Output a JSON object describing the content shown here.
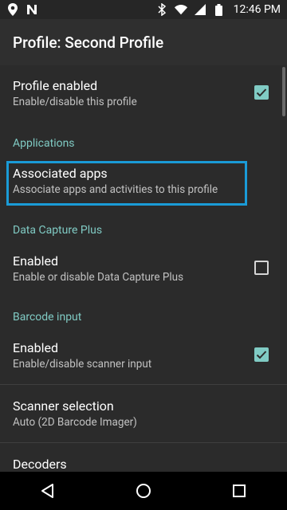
{
  "status": {
    "time": "12:46 PM"
  },
  "appbar": {
    "title": "Profile: Second Profile"
  },
  "items": {
    "profile_enabled": {
      "title": "Profile enabled",
      "summary": "Enable/disable this profile",
      "checked": true
    },
    "cat_applications": "Applications",
    "associated_apps": {
      "title": "Associated apps",
      "summary": "Associate apps and activities to this profile"
    },
    "cat_dcp": "Data Capture Plus",
    "dcp_enabled": {
      "title": "Enabled",
      "summary": "Enable or disable Data Capture Plus",
      "checked": false
    },
    "cat_barcode": "Barcode input",
    "barcode_enabled": {
      "title": "Enabled",
      "summary": "Enable/disable scanner input",
      "checked": true
    },
    "scanner_selection": {
      "title": "Scanner selection",
      "summary": "Auto (2D Barcode Imager)"
    },
    "decoders": {
      "title": "Decoders"
    }
  },
  "colors": {
    "accent": "#80cbc4",
    "highlight": "#1a9bd7"
  }
}
